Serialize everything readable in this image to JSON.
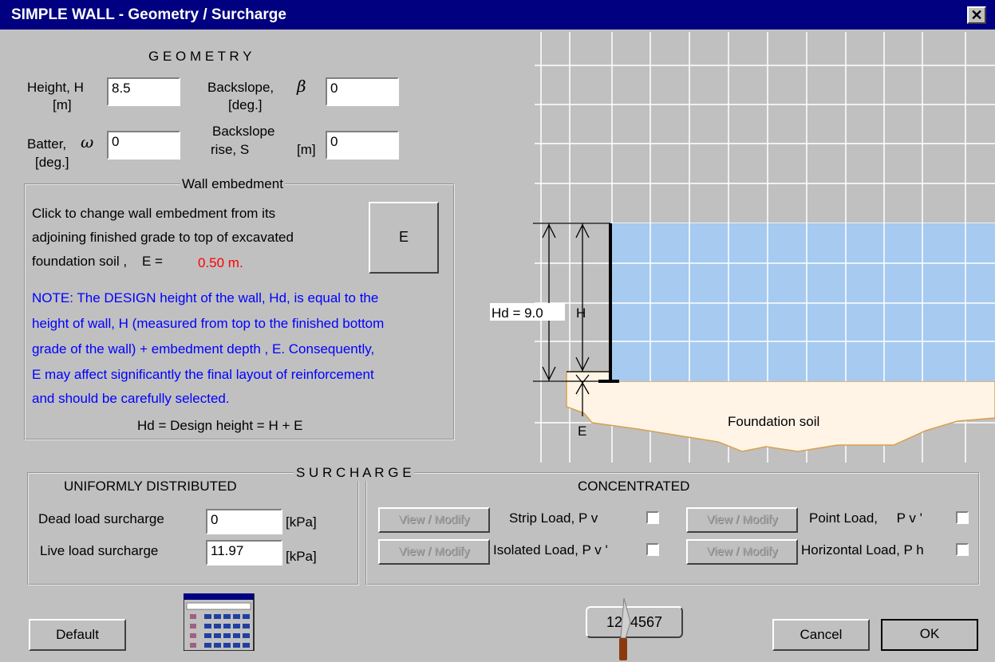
{
  "window": {
    "title": "SIMPLE WALL - Geometry / Surcharge",
    "close_glyph": "✕"
  },
  "geometry": {
    "heading": "G E O M E T R Y",
    "height_label_1": "Height, H",
    "height_label_2": "[m]",
    "height_value": "8.5",
    "backslope_label_1": "Backslope,",
    "backslope_symbol": "β",
    "backslope_label_2": "[deg.]",
    "backslope_value": "0",
    "batter_label_1": "Batter,",
    "batter_symbol": "ω",
    "batter_label_2": "[deg.]",
    "batter_value": "0",
    "rise_label_1": "Backslope",
    "rise_label_2": "rise, S",
    "rise_unit": "[m]",
    "rise_value": "0"
  },
  "embedment": {
    "legend": "Wall embedment",
    "line1": "Click to change wall embedment from its",
    "line2": "adjoining finished grade to top of excavated",
    "line3": "foundation soil ,    E =",
    "e_value": "0.50 m.",
    "button": "E",
    "note1": "NOTE: The DESIGN height of the wall, Hd, is equal to the",
    "note2": "height of wall, H (measured from top to the finished bottom",
    "note3": "grade of the wall) + embedment depth , E.  Consequently,",
    "note4": "E may affect significantly the final layout of reinforcement",
    "note5": "and should be carefully selected.",
    "formula": "Hd = Design height = H + E"
  },
  "diagram": {
    "hd_label": "Hd = 9.0",
    "h_label": "H",
    "e_label": "E",
    "soil_label": "Foundation soil",
    "fill_color": "#a6caf0",
    "soil_color": "#fff4e6"
  },
  "surcharge": {
    "heading": "S U R C H A R G E",
    "uniform_heading": "UNIFORMLY  DISTRIBUTED",
    "dead_label": "Dead load surcharge",
    "dead_value": "0",
    "dead_unit": "[kPa]",
    "live_label": "Live load surcharge",
    "live_value": "11.97",
    "live_unit": "[kPa]",
    "concentrated_heading": "CONCENTRATED",
    "view_modify": "View / Modify",
    "strip_label": "Strip  Load,  P v",
    "isolated_label": "Isolated Load,  P v '",
    "point_label": "Point Load,     P v '",
    "horizontal_label": "Horizontal Load,  P h"
  },
  "footer": {
    "default_button": "Default",
    "counter": "1234567",
    "cancel_button": "Cancel",
    "ok_button": "OK"
  }
}
